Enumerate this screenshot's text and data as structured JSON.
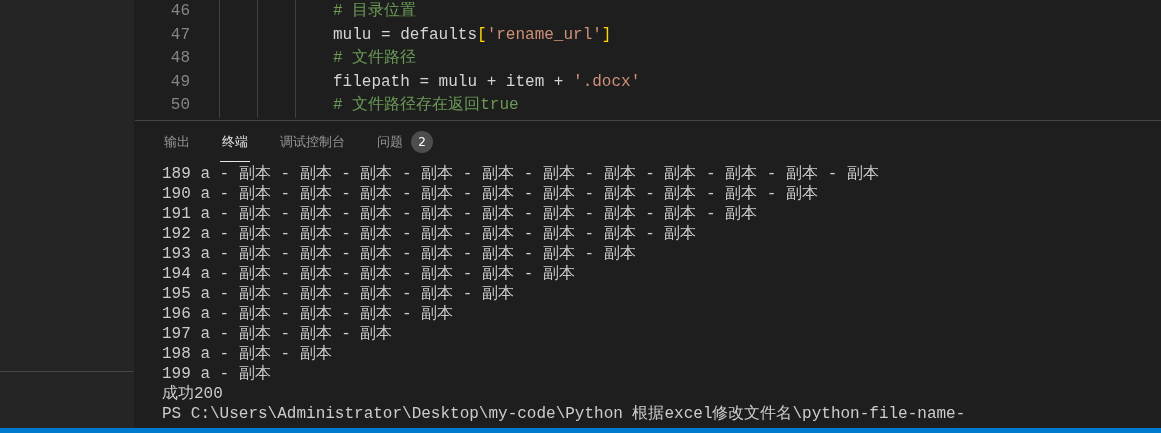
{
  "editor": {
    "lines": [
      {
        "number": "46",
        "tokens": [
          {
            "kind": "comment",
            "text": "# 目录位置"
          }
        ]
      },
      {
        "number": "47",
        "tokens": [
          {
            "kind": "plain",
            "text": "mulu = defaults"
          },
          {
            "kind": "bracket",
            "text": "["
          },
          {
            "kind": "string",
            "text": "'rename_url'"
          },
          {
            "kind": "bracket",
            "text": "]"
          }
        ]
      },
      {
        "number": "48",
        "tokens": [
          {
            "kind": "comment",
            "text": "# 文件路径"
          }
        ]
      },
      {
        "number": "49",
        "tokens": [
          {
            "kind": "plain",
            "text": "filepath = mulu + item + "
          },
          {
            "kind": "string",
            "text": "'.docx'"
          }
        ]
      },
      {
        "number": "50",
        "tokens": [
          {
            "kind": "comment",
            "text": "# 文件路径存在返回true"
          }
        ]
      }
    ]
  },
  "panel": {
    "tabs": [
      {
        "label": "输出",
        "selected": false
      },
      {
        "label": "终端",
        "selected": true
      },
      {
        "label": "调试控制台",
        "selected": false
      },
      {
        "label": "问题",
        "selected": false,
        "badge": "2"
      }
    ]
  },
  "terminal": {
    "lines": [
      "189 a - 副本 - 副本 - 副本 - 副本 - 副本 - 副本 - 副本 - 副本 - 副本 - 副本 - 副本",
      "190 a - 副本 - 副本 - 副本 - 副本 - 副本 - 副本 - 副本 - 副本 - 副本 - 副本",
      "191 a - 副本 - 副本 - 副本 - 副本 - 副本 - 副本 - 副本 - 副本 - 副本",
      "192 a - 副本 - 副本 - 副本 - 副本 - 副本 - 副本 - 副本 - 副本",
      "193 a - 副本 - 副本 - 副本 - 副本 - 副本 - 副本 - 副本",
      "194 a - 副本 - 副本 - 副本 - 副本 - 副本 - 副本",
      "195 a - 副本 - 副本 - 副本 - 副本 - 副本",
      "196 a - 副本 - 副本 - 副本 - 副本",
      "197 a - 副本 - 副本 - 副本",
      "198 a - 副本 - 副本",
      "199 a - 副本",
      "成功200",
      "PS C:\\Users\\Administrator\\Desktop\\my-code\\Python 根据excel修改文件名\\python-file-name-"
    ]
  }
}
